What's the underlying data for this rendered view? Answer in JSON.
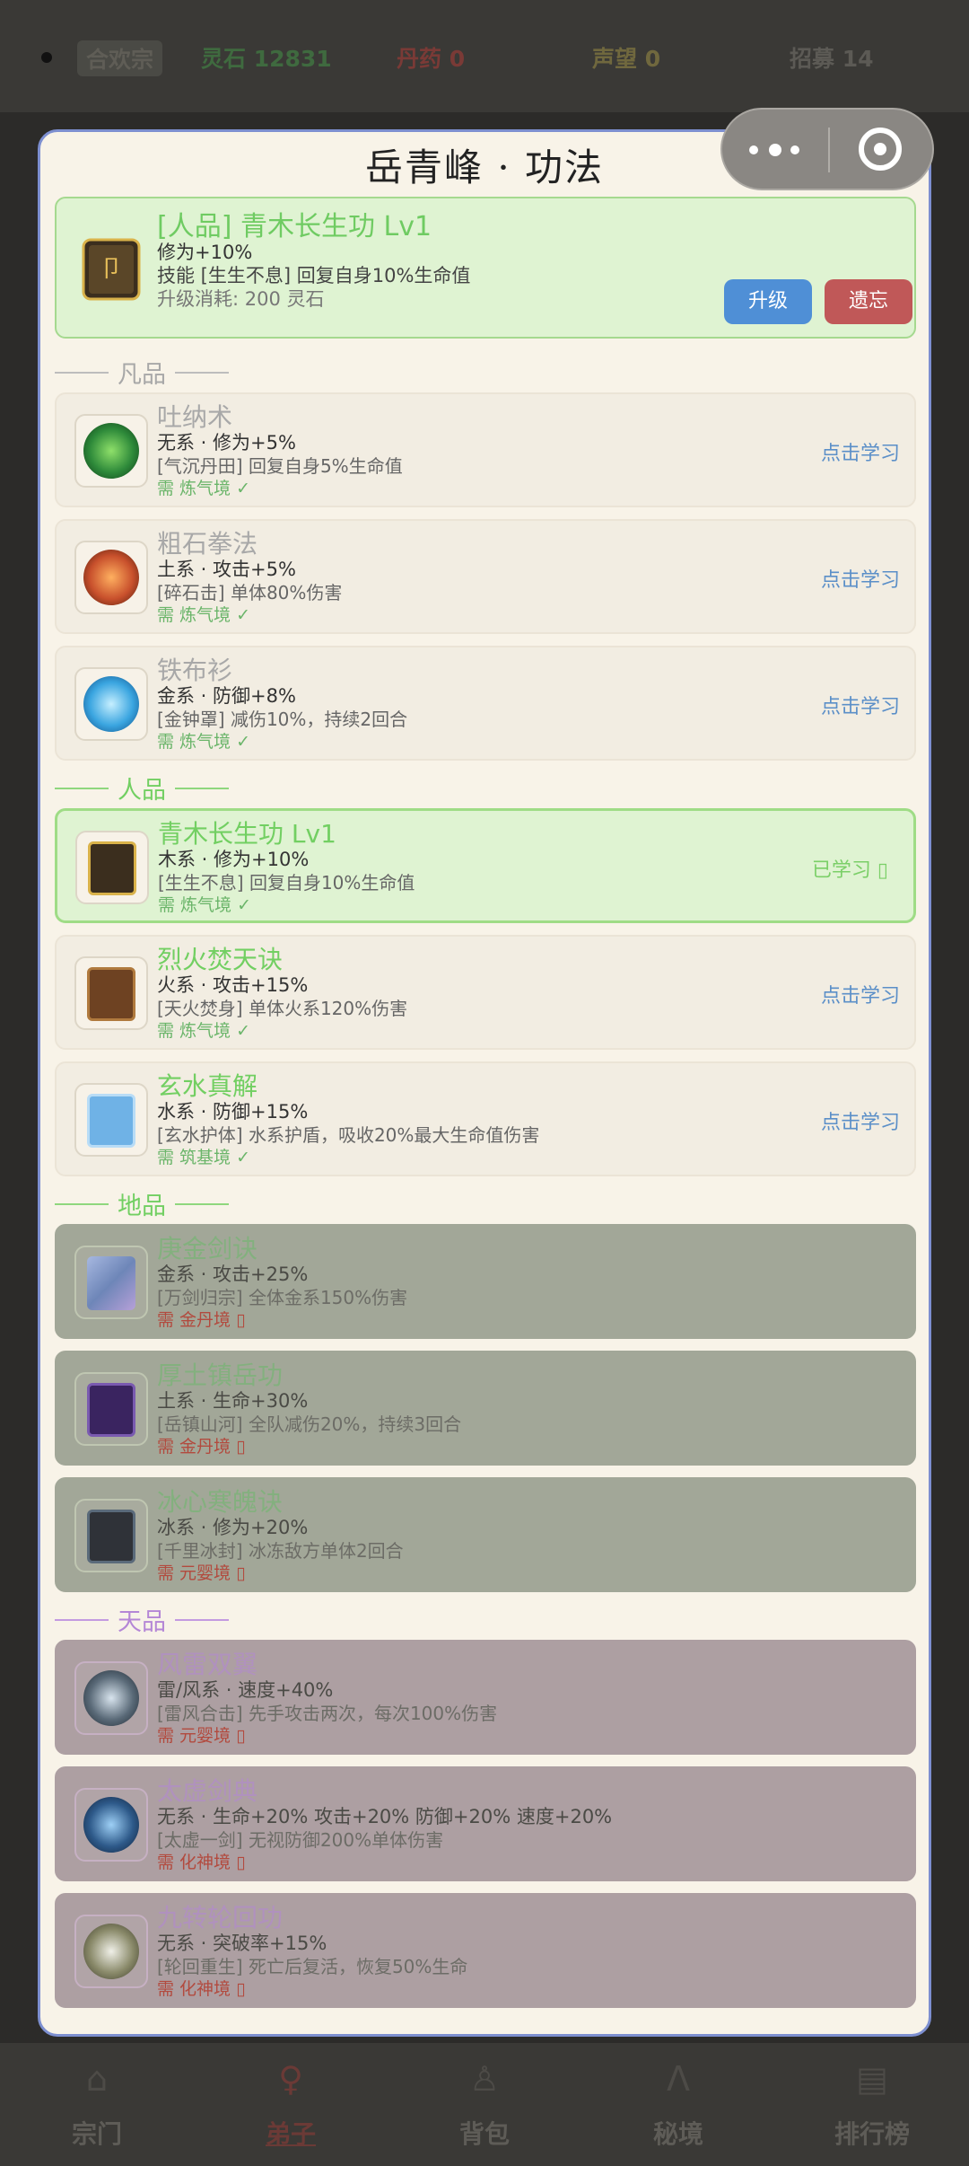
{
  "topbar": {
    "sect": "合欢宗",
    "stats": [
      "灵石 12831",
      "丹药 0",
      "声望 0",
      "招募 14"
    ]
  },
  "bottomnav": [
    {
      "label": "宗门",
      "icon": "temple-icon"
    },
    {
      "label": "弟子",
      "icon": "disciple-icon",
      "active": true
    },
    {
      "label": "背包",
      "icon": "bag-icon"
    },
    {
      "label": "秘境",
      "icon": "mountain-icon"
    },
    {
      "label": "排行榜",
      "icon": "ranking-icon"
    }
  ],
  "modal": {
    "title": "岳青峰 · 功法",
    "current": {
      "title": "[人品] 青木长生功  Lv1",
      "line1": "修为+10%",
      "line2": "技能 [生生不息] 回复自身10%生命值",
      "line3": "升级消耗: 200 灵石",
      "upgrade_label": "升级",
      "forget_label": "遗忘"
    },
    "sections": {
      "fan": "凡品",
      "ren": "人品",
      "di": "地品",
      "tian": "天品"
    },
    "skills": [
      {
        "name": "吐纳术",
        "l1": "无系 · 修为+5%",
        "l2": "[气沉丹田] 回复自身5%生命值",
        "l3": "需 炼气境 ✓",
        "action": "点击学习",
        "color": "#2e8a3a"
      },
      {
        "name": "粗石拳法",
        "l1": "土系 · 攻击+5%",
        "l2": "[碎石击] 单体80%伤害",
        "l3": "需 炼气境 ✓",
        "action": "点击学习",
        "color": "#c8502c"
      },
      {
        "name": "铁布衫",
        "l1": "金系 · 防御+8%",
        "l2": "[金钟罩] 减伤10%，持续2回合",
        "l3": "需 炼气境 ✓",
        "action": "点击学习",
        "color": "#3aa5e0"
      },
      {
        "name": "青木长生功  Lv1",
        "l1": "木系 · 修为+10%",
        "l2": "[生生不息] 回复自身10%生命值",
        "l3": "需 炼气境 ✓",
        "action": "已学习 ▯",
        "color": "#c39a44"
      },
      {
        "name": "烈火焚天诀",
        "l1": "火系 · 攻击+15%",
        "l2": "[天火焚身] 单体火系120%伤害",
        "l3": "需 炼气境 ✓",
        "action": "点击学习",
        "color": "#a66a32"
      },
      {
        "name": "玄水真解",
        "l1": "水系 · 防御+15%",
        "l2": "[玄水护体] 水系护盾，吸收20%最大生命值伤害",
        "l3": "需 筑基境 ✓",
        "action": "点击学习",
        "color": "#6fb2e6"
      },
      {
        "name": "庚金剑诀",
        "l1": "金系 · 攻击+25%",
        "l2": "[万剑归宗] 全体金系150%伤害",
        "l3": "需 金丹境 ▯",
        "color": "#6e86b8"
      },
      {
        "name": "厚土镇岳功",
        "l1": "土系 · 生命+30%",
        "l2": "[岳镇山河] 全队减伤20%，持续3回合",
        "l3": "需 金丹境 ▯",
        "color": "#5b3a86"
      },
      {
        "name": "冰心寒魄诀",
        "l1": "冰系 · 修为+20%",
        "l2": "[千里冰封] 冰冻敌方单体2回合",
        "l3": "需 元婴境 ▯",
        "color": "#2f3238"
      },
      {
        "name": "风雷双翼",
        "l1": "雷/风系 · 速度+40%",
        "l2": "[雷风合击] 先手攻击两次，每次100%伤害",
        "l3": "需 元婴境 ▯",
        "color": "#5a6a78"
      },
      {
        "name": "太虚剑典",
        "l1": "无系 · 生命+20%  攻击+20%  防御+20%  速度+20%",
        "l2": "[太虚一剑] 无视防御200%单体伤害",
        "l3": "需 化神境 ▯",
        "color": "#2e5a8a"
      },
      {
        "name": "九转轮回功",
        "l1": "无系 · 突破率+15%",
        "l2": "[轮回重生] 死亡后复活，恢复50%生命",
        "l3": "需 化神境 ▯",
        "color": "#8a8a6a"
      }
    ]
  }
}
